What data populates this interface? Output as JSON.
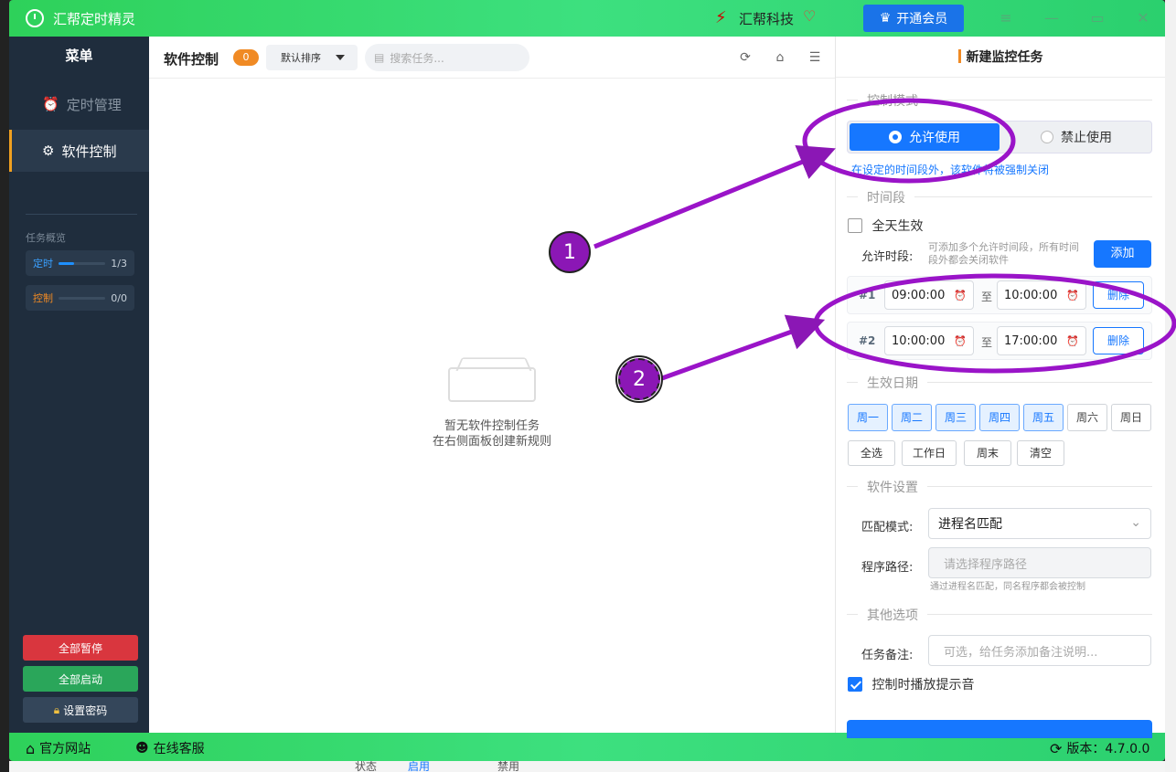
{
  "window": {
    "title": "汇帮定时精灵",
    "brand": "汇帮科技",
    "vip_button": "开通会员"
  },
  "sidebar": {
    "menu_title": "菜单",
    "items": [
      {
        "label": "定时管理",
        "icon": "alarm-clock-icon",
        "active": false
      },
      {
        "label": "软件控制",
        "icon": "gear-icon",
        "active": true
      }
    ],
    "overview_title": "任务概览",
    "overview": [
      {
        "label": "定时",
        "value": "1/3",
        "progress": 0.33,
        "color": "#1e90ff"
      },
      {
        "label": "控制",
        "value": "0/0",
        "progress": 0,
        "color": "#f08a24"
      }
    ],
    "buttons": {
      "pause_all": "全部暂停",
      "start_all": "全部启动",
      "set_password": "设置密码"
    },
    "colors": {
      "pause": "#d9363e",
      "start": "#2aa65a",
      "password": "#34465a"
    }
  },
  "middle": {
    "title": "软件控制",
    "count": "0",
    "sort_label": "默认排序",
    "search_placeholder": "搜索任务...",
    "empty_line1": "暂无软件控制任务",
    "empty_line2": "在右侧面板创建新规则"
  },
  "annotations": {
    "marker1": "1",
    "marker2": "2"
  },
  "panel": {
    "title": "新建监控任务",
    "section_mode": "控制模式",
    "mode_allow": "允许使用",
    "mode_deny": "禁止使用",
    "mode_hint": "在设定的时间段外，该软件将被强制关闭",
    "section_time": "时间段",
    "all_day": "全天生效",
    "allowed_label": "允许时段:",
    "allowed_note": "可添加多个允许时间段，所有时间段外都会关闭软件",
    "add_button": "添加",
    "slots": [
      {
        "index": "#1",
        "start": "09:00:00",
        "end": "10:00:00",
        "delete": "删除"
      },
      {
        "index": "#2",
        "start": "10:00:00",
        "end": "17:00:00",
        "delete": "删除"
      }
    ],
    "to_label": "至",
    "section_days": "生效日期",
    "days": [
      {
        "label": "周一",
        "selected": true
      },
      {
        "label": "周二",
        "selected": true
      },
      {
        "label": "周三",
        "selected": true
      },
      {
        "label": "周四",
        "selected": true
      },
      {
        "label": "周五",
        "selected": true
      },
      {
        "label": "周六",
        "selected": false
      },
      {
        "label": "周日",
        "selected": false
      }
    ],
    "quick": [
      "全选",
      "工作日",
      "周末",
      "清空"
    ],
    "section_software": "软件设置",
    "match_label": "匹配模式:",
    "match_value": "进程名匹配",
    "path_label": "程序路径:",
    "path_placeholder": "请选择程序路径",
    "path_note": "通过进程名匹配，同名程序都会被控制",
    "section_other": "其他选项",
    "note_label": "任务备注:",
    "note_placeholder": "可选，给任务添加备注说明...",
    "sound_label": "控制时播放提示音"
  },
  "statusbar": {
    "website": "官方网站",
    "support": "在线客服",
    "version": "版本：4.7.0.0"
  },
  "background": {
    "status_label": "状态",
    "enable": "启用",
    "disable": "禁用"
  }
}
